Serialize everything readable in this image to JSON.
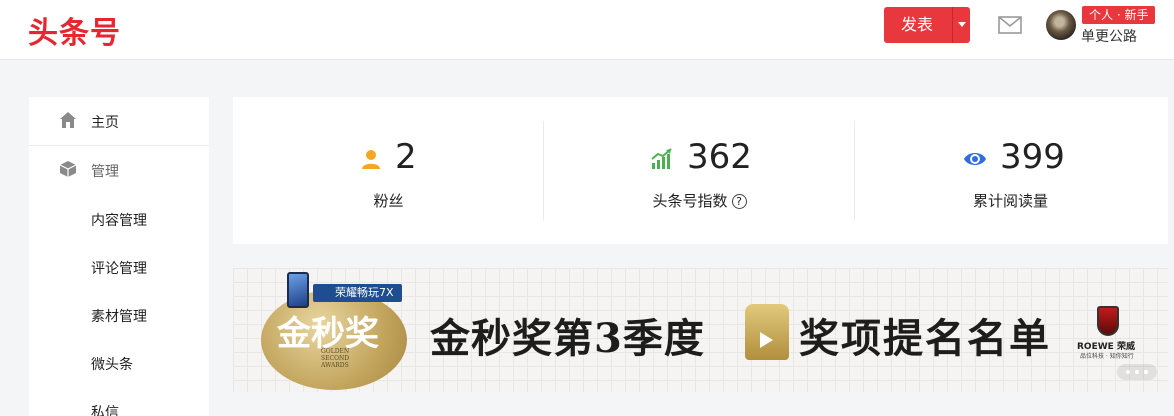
{
  "header": {
    "logo": "头条号",
    "publish_label": "发表",
    "badge": "个人 · 新手",
    "username": "单更公路"
  },
  "sidebar": {
    "items": [
      {
        "label": "主页",
        "icon": "home-icon"
      },
      {
        "label": "管理",
        "icon": "cube-icon"
      },
      {
        "label": "内容管理"
      },
      {
        "label": "评论管理"
      },
      {
        "label": "素材管理"
      },
      {
        "label": "微头条"
      },
      {
        "label": "私信"
      }
    ]
  },
  "stats": [
    {
      "value": "2",
      "label": "粉丝",
      "icon": "user-icon",
      "color": "#f5a623"
    },
    {
      "value": "362",
      "label": "头条号指数",
      "icon": "trend-up-icon",
      "color": "#4caf50",
      "help": "?"
    },
    {
      "value": "399",
      "label": "累计阅读量",
      "icon": "eye-icon",
      "color": "#2d6de0"
    }
  ],
  "banner": {
    "tag": "荣耀畅玩7X",
    "emblem": "金秒奖",
    "emblem_sub": [
      "GOLDEN",
      "SECOND",
      "AWARDS"
    ],
    "headline_left": "金秒奖第3季度",
    "headline_right": "奖项提名名单",
    "sponsor": "ROEWE 荣威",
    "sponsor_slogan": "品位科技 · 知你知行"
  },
  "colors": {
    "brand": "#e8262f",
    "accent": "#e8383d"
  }
}
